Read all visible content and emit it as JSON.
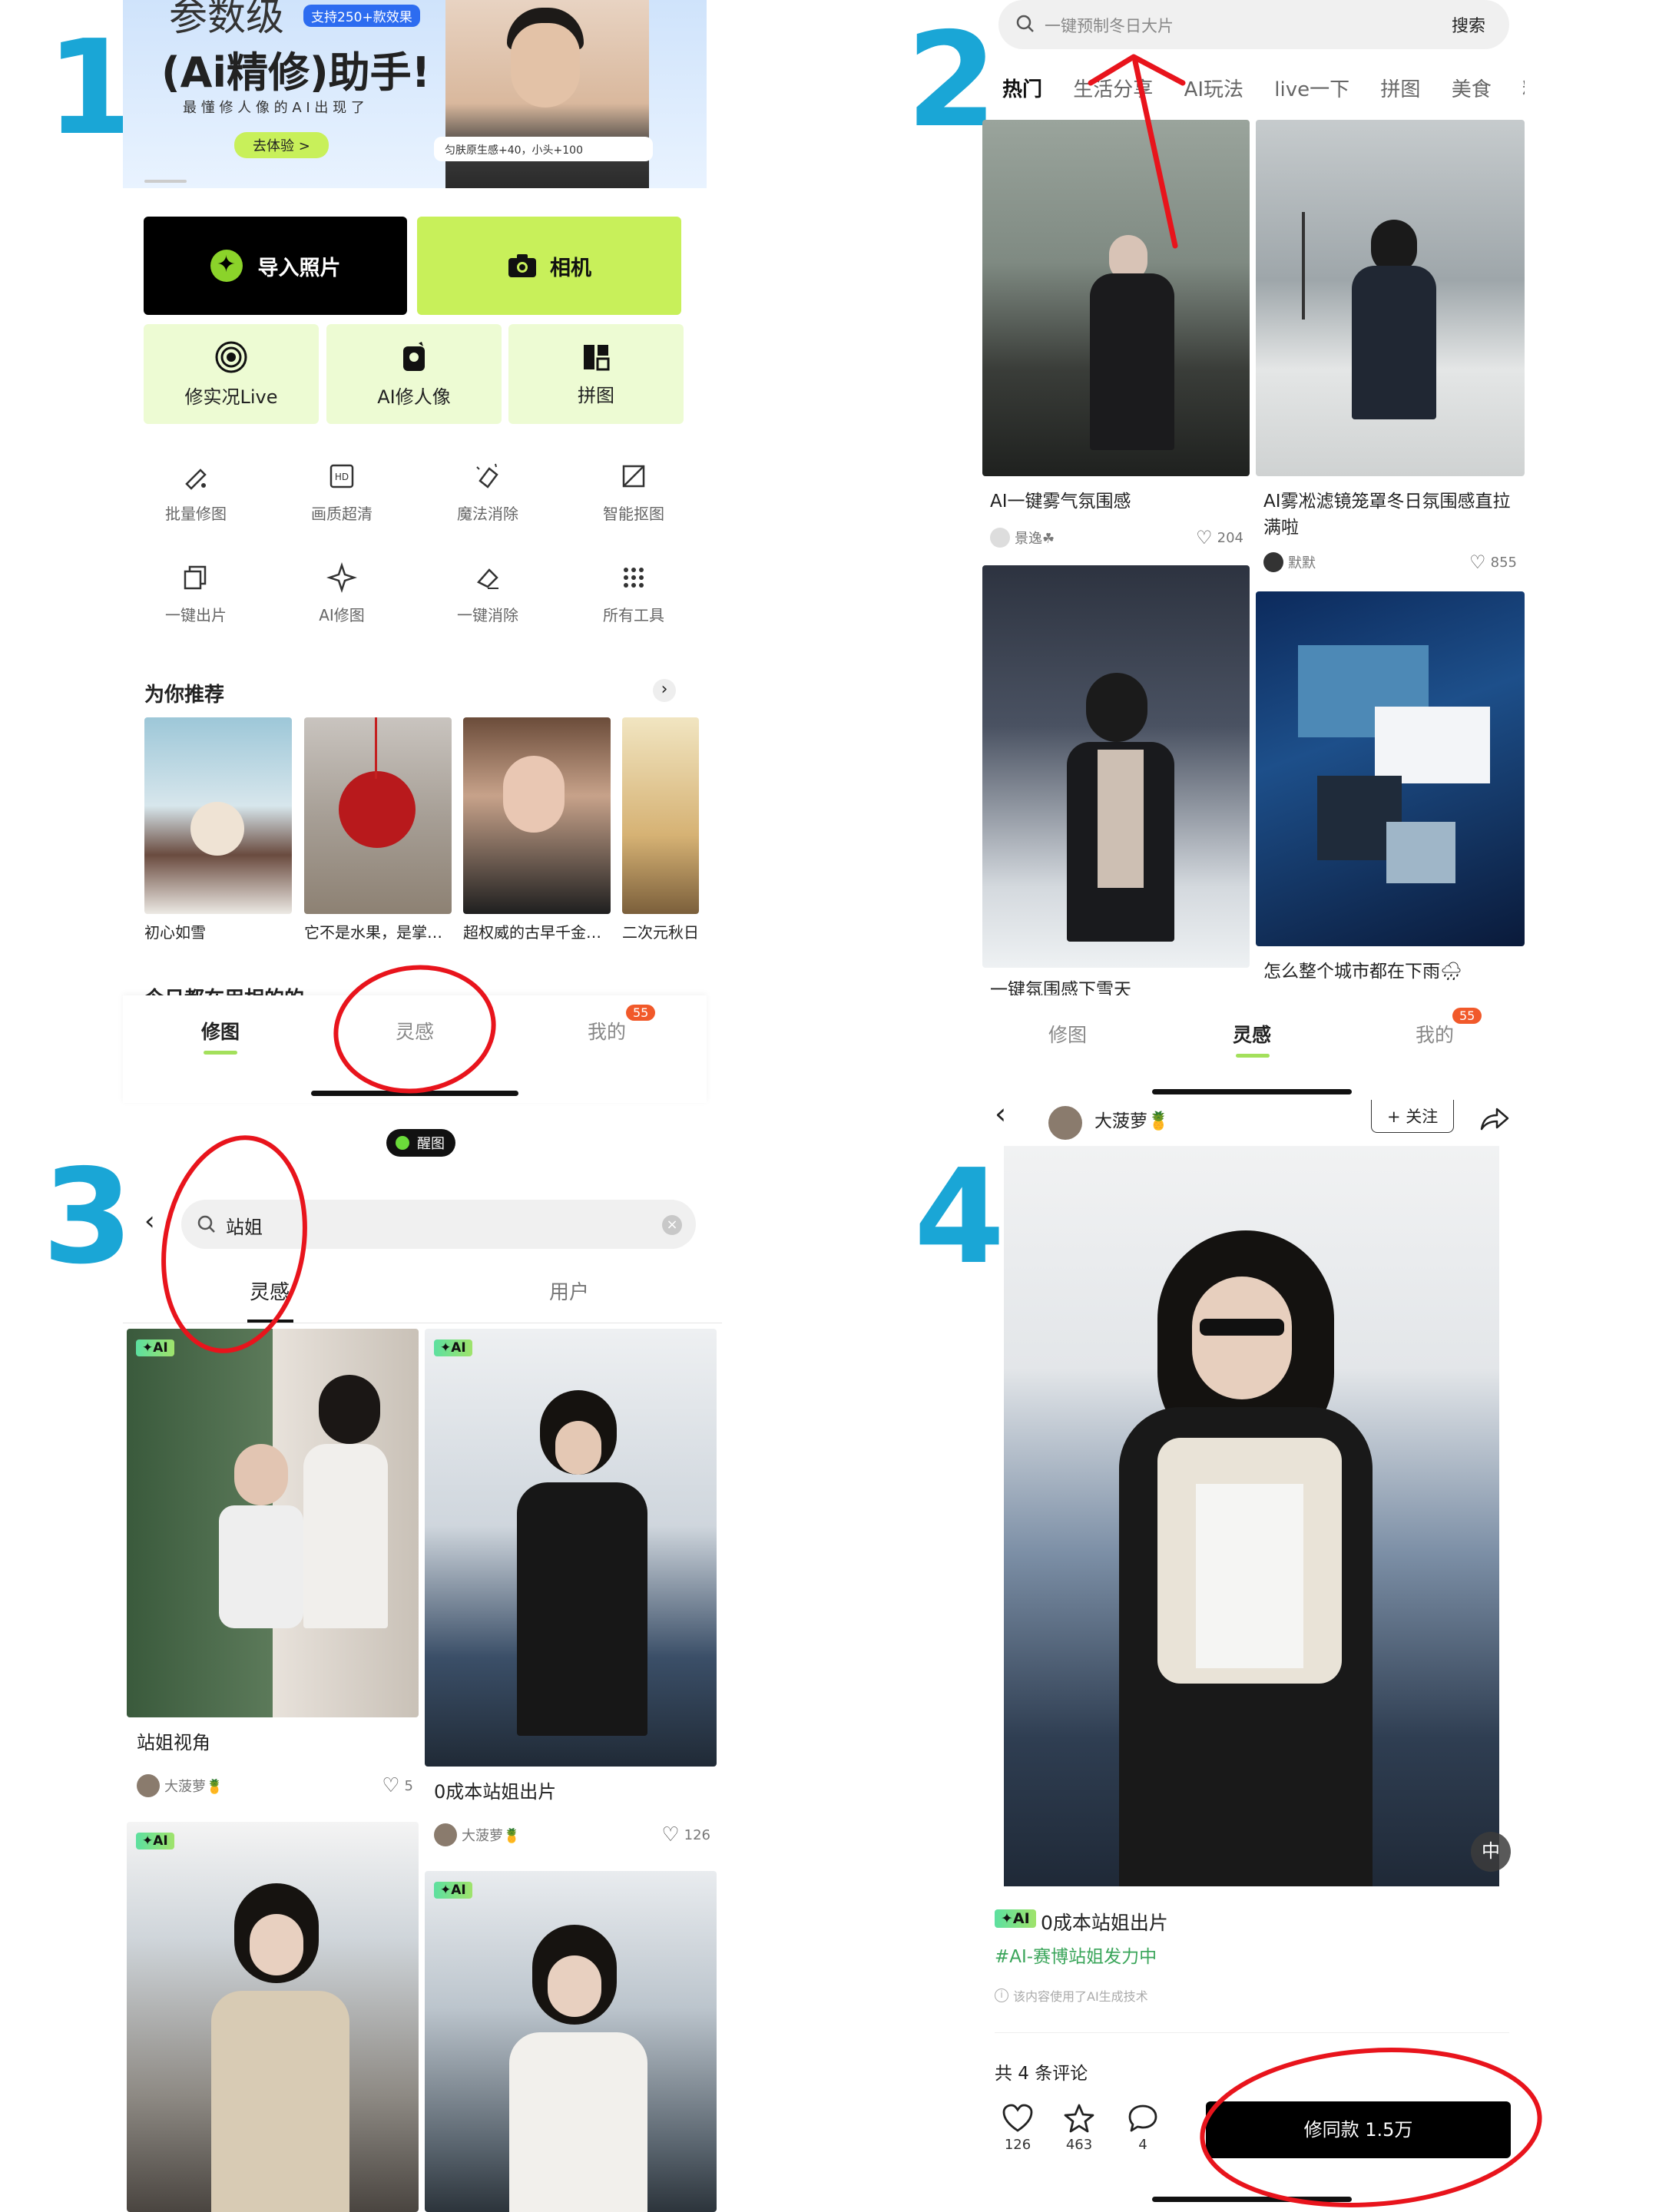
{
  "step_numbers": [
    "1",
    "2",
    "3",
    "4"
  ],
  "p1": {
    "banner": {
      "title_line1": "参数级",
      "badge": "支持250+款效果",
      "title_line2": "(Ai精修)助手!",
      "subtitle": "最 懂 修 人 像 的 A I 出 现 了",
      "cta": "去体验 >",
      "face_caption": "匀肤原生感+40，小头+100"
    },
    "import_btn": "导入照片",
    "camera_btn": "相机",
    "squares": [
      "修实况Live",
      "AI修人像",
      "拼图"
    ],
    "tools_row1": [
      "批量修图",
      "画质超清",
      "魔法消除",
      "智能抠图"
    ],
    "tools_row2": [
      "一键出片",
      "AI修图",
      "一键消除",
      "所有工具"
    ],
    "recommend_title": "为你推荐",
    "rec_items": [
      "初心如雪",
      "它不是水果，是掌…",
      "超权威的古早千金…",
      "二次元秋日"
    ],
    "partial_text": "今日都在用相的的…",
    "tabs": [
      "修图",
      "灵感",
      "我的"
    ],
    "badge_count": "55"
  },
  "p2": {
    "search_placeholder": "一键预制冬日大片",
    "search_btn": "搜索",
    "tabs": [
      "热门",
      "生活分享",
      "AI玩法",
      "live一下",
      "拼图",
      "美食",
      "粉丝"
    ],
    "cards": [
      {
        "title": "AI一键雾气氛围感",
        "user": "景逸☘",
        "likes": "204"
      },
      {
        "title": "AI雾凇滤镜笼罩冬日氛围感直拉满啦",
        "user": "默默",
        "likes": "855"
      },
      {
        "title": "一键氛围感下雪天",
        "user": "",
        "likes": ""
      },
      {
        "title": "怎么整个城市都在下雨🌧",
        "user": "",
        "likes": ""
      }
    ],
    "bottom_tabs": [
      "修图",
      "灵感",
      "我的"
    ],
    "badge_count": "55"
  },
  "p3": {
    "pill": "醒图",
    "search_value": "站姐",
    "tabs": [
      "灵感",
      "用户"
    ],
    "ai_tag": "✦AI",
    "cards": [
      {
        "title": "站姐视角",
        "user": "大菠萝🍍",
        "likes": "5"
      },
      {
        "title": "0成本站姐出片",
        "user": "大菠萝🍍",
        "likes": "126"
      }
    ]
  },
  "p4": {
    "author": "大菠萝🍍",
    "follow": "+ 关注",
    "ai_tag": "✦AI",
    "title": "0成本站姐出片",
    "hashtag": "#AI-赛博站姐发力中",
    "disclaimer": "该内容使用了AI生成技术",
    "comments": "共 4 条评论",
    "likes": "126",
    "stars": "463",
    "comment_count": "4",
    "cta": "修同款 1.5万",
    "corner_btn": "中"
  },
  "colors": {
    "accent": "#c8f05a",
    "step": "#1aa6d6",
    "annotation": "#e8141c",
    "badge": "#f1592a"
  }
}
